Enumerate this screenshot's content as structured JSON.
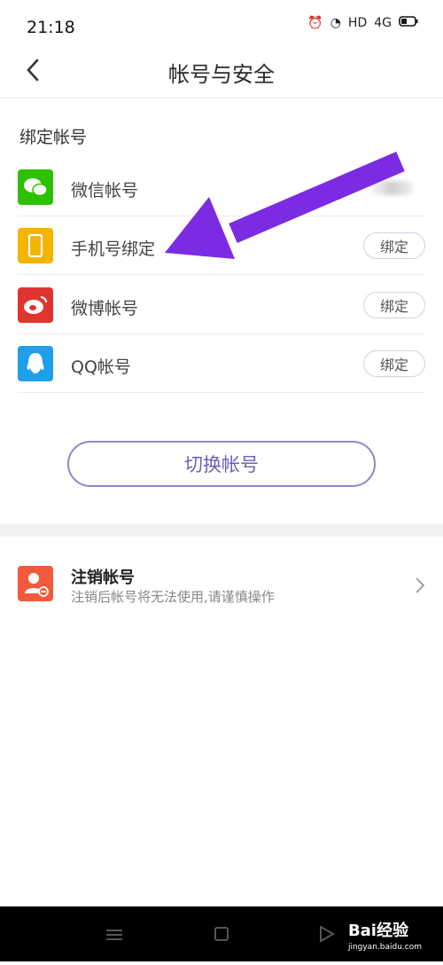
{
  "status": {
    "time": "21:18",
    "hd": "HD",
    "signal": "4G"
  },
  "header": {
    "title": "帐号与安全"
  },
  "section": {
    "label": "绑定帐号"
  },
  "accounts": [
    {
      "label": "微信帐号",
      "button": "",
      "color": "#2dc100",
      "icon": "wechat-icon"
    },
    {
      "label": "手机号绑定",
      "button": "绑定",
      "color": "#f4b400",
      "icon": "phone-icon"
    },
    {
      "label": "微博帐号",
      "button": "绑定",
      "color": "#e0352e",
      "icon": "weibo-icon"
    },
    {
      "label": "QQ帐号",
      "button": "绑定",
      "color": "#1e9fe9",
      "icon": "qq-icon"
    }
  ],
  "switch_button": "切换帐号",
  "cancel": {
    "title": "注销帐号",
    "subtitle": "注销后帐号将无法使用,请谨慎操作"
  },
  "watermark": {
    "brand": "Bai经验",
    "url": "jingyan.baidu.com"
  },
  "colors": {
    "accent": "#6b62b5",
    "arrow": "#7b2be1"
  }
}
